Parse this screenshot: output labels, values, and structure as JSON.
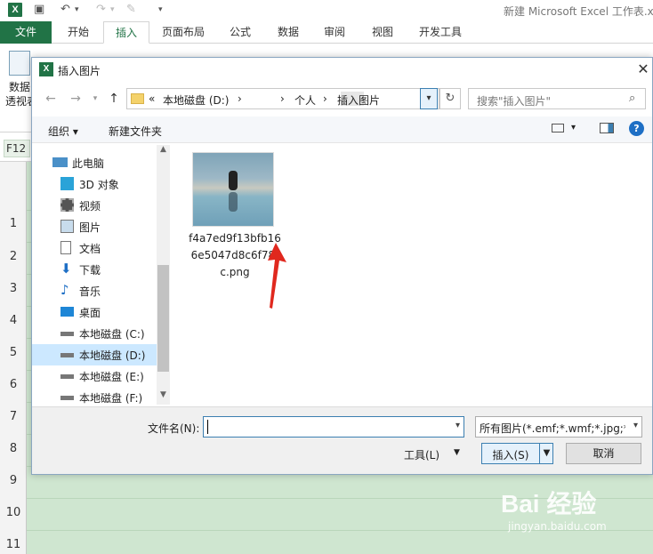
{
  "excel": {
    "logo": "X",
    "window_title": "新建 Microsoft Excel 工作表.x",
    "file_tab": "文件",
    "tabs": [
      "开始",
      "插入",
      "页面布局",
      "公式",
      "数据",
      "审阅",
      "视图",
      "开发工具"
    ],
    "active_tab": "插入",
    "ribbon_button_line1": "数据",
    "ribbon_button_line2": "透视表",
    "name_box": "F12",
    "row_numbers": [
      "1",
      "2",
      "3",
      "4",
      "5",
      "6",
      "7",
      "8",
      "9",
      "10",
      "11"
    ]
  },
  "dialog": {
    "title": "插入图片",
    "address": {
      "overflow": "«",
      "drive": "本地磁盘 (D:)",
      "folder1": "个人",
      "folder2": "插入图片"
    },
    "search_placeholder": "搜索\"插入图片\"",
    "toolbar": {
      "organize": "组织 ▾",
      "new_folder": "新建文件夹",
      "help": "?"
    },
    "nav_items": [
      {
        "label": "此电脑",
        "icon": "computer-icon"
      },
      {
        "label": "3D 对象",
        "icon": "cube-icon"
      },
      {
        "label": "视频",
        "icon": "video-icon"
      },
      {
        "label": "图片",
        "icon": "pictures-icon"
      },
      {
        "label": "文档",
        "icon": "document-icon"
      },
      {
        "label": "下载",
        "icon": "download-icon"
      },
      {
        "label": "音乐",
        "icon": "music-icon"
      },
      {
        "label": "桌面",
        "icon": "desktop-icon"
      },
      {
        "label": "本地磁盘 (C:)",
        "icon": "drive-icon"
      },
      {
        "label": "本地磁盘 (D:)",
        "icon": "drive-icon",
        "selected": true
      },
      {
        "label": "本地磁盘 (E:)",
        "icon": "drive-icon"
      },
      {
        "label": "本地磁盘 (F:)",
        "icon": "drive-icon"
      }
    ],
    "file": {
      "name": "f4a7ed9f13bfb166e5047d8c6f78fc.png"
    },
    "filename_label": "文件名(N):",
    "filename_value": "",
    "filetype": "所有图片(*.emf;*.wmf;*.jpg;*.jp",
    "tools_label": "工具(L)",
    "insert_label": "插入(S)",
    "cancel_label": "取消"
  },
  "watermark": {
    "brand": "Bai 经验",
    "url": "jingyan.baidu.com"
  },
  "colors": {
    "excel_green": "#217346",
    "sheet_bg": "#cfe6d0",
    "selection_blue": "#cce8ff",
    "annotation_red": "#e0281e"
  }
}
